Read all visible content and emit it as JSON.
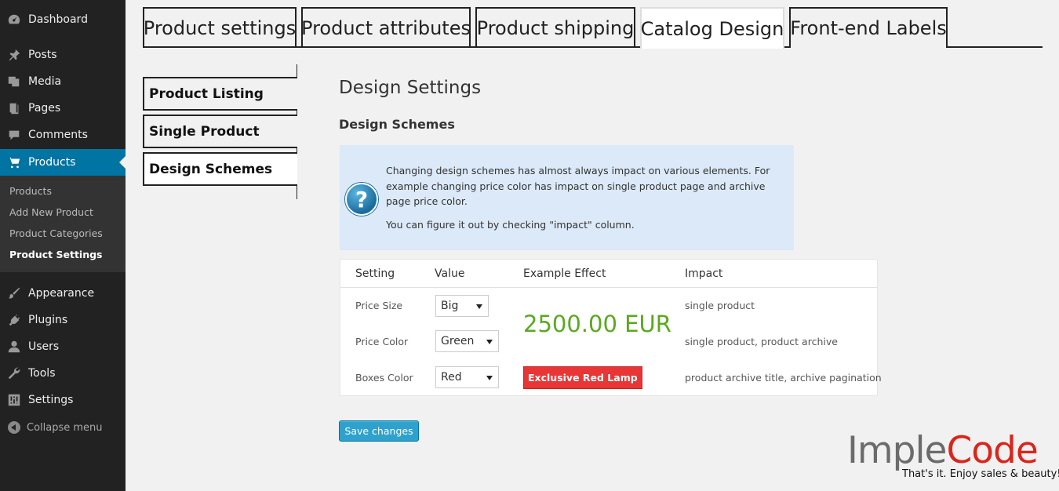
{
  "sidebar": {
    "items": [
      {
        "label": "Dashboard",
        "icon": "dashboard-icon"
      },
      {
        "label": "Posts",
        "icon": "pin-icon"
      },
      {
        "label": "Media",
        "icon": "media-icon"
      },
      {
        "label": "Pages",
        "icon": "pages-icon"
      },
      {
        "label": "Comments",
        "icon": "comment-icon"
      },
      {
        "label": "Products",
        "icon": "cart-icon"
      },
      {
        "label": "Appearance",
        "icon": "brush-icon"
      },
      {
        "label": "Plugins",
        "icon": "plug-icon"
      },
      {
        "label": "Users",
        "icon": "user-icon"
      },
      {
        "label": "Tools",
        "icon": "wrench-icon"
      },
      {
        "label": "Settings",
        "icon": "sliders-icon"
      }
    ],
    "submenu": [
      "Products",
      "Add New Product",
      "Product Categories",
      "Product Settings"
    ],
    "collapse_label": "Collapse menu"
  },
  "tabs": [
    "Product settings",
    "Product attributes",
    "Product shipping",
    "Catalog Design",
    "Front-end Labels"
  ],
  "subtabs": [
    "Product Listing",
    "Single Product",
    "Design Schemes"
  ],
  "main": {
    "title": "Design Settings",
    "section_title": "Design Schemes",
    "info": {
      "text1": "Changing design schemes has almost always impact on various elements. For example changing price color has impact on single product page and archive page price color.",
      "text2": "You can figure it out by checking \"impact\" column.",
      "icon": "question-icon"
    },
    "table": {
      "headers": [
        "Setting",
        "Value",
        "Example Effect",
        "Impact"
      ],
      "rows": [
        {
          "setting": "Price Size",
          "value": "Big",
          "impact": "single product"
        },
        {
          "setting": "Price Color",
          "value": "Green",
          "impact": "single product, product archive"
        },
        {
          "setting": "Boxes Color",
          "value": "Red",
          "impact": "product archive title, archive pagination"
        }
      ],
      "price_example": "2500.00 EUR",
      "box_example": "Exclusive Red Lamp"
    },
    "save_label": "Save changes"
  },
  "logo": {
    "part1": "Imple",
    "part2": "Code",
    "tagline": "That's it. Enjoy sales & beauty!"
  },
  "colors": {
    "sidebar_bg": "#222222",
    "active_menu": "#0074a2",
    "price_green": "#5ba821",
    "box_red": "#e83535",
    "button_blue": "#2ea2cc",
    "info_bg": "#dbe9f8"
  }
}
